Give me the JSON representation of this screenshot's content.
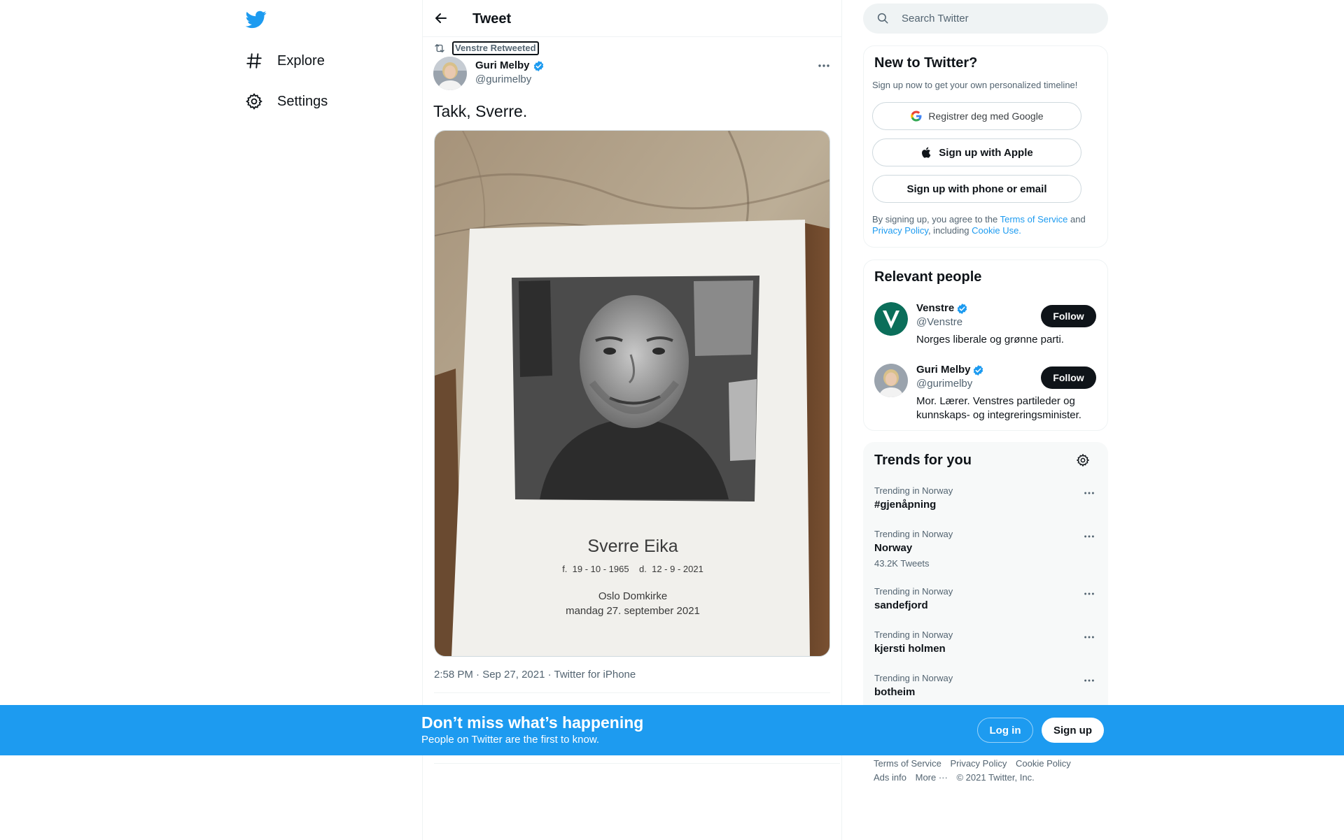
{
  "colors": {
    "brand": "#1d9bf0",
    "text": "#0f1419",
    "secondary_text": "#536471",
    "banner": "#1d9bf0"
  },
  "nav": {
    "logo_icon": "twitter-bird-icon",
    "items": [
      {
        "label": "Explore",
        "icon": "hashtag-icon"
      },
      {
        "label": "Settings",
        "icon": "gear-icon"
      }
    ]
  },
  "header": {
    "title": "Tweet",
    "back_icon": "arrow-left-icon"
  },
  "tweet": {
    "retweeted_by": "Venstre Retweeted",
    "author_name": "Guri Melby",
    "author_handle": "@gurimelby",
    "text": "Takk, Sverre.",
    "photo_card": {
      "name": "Sverre Eika",
      "dates": "f.  19 - 10 - 1965    d.  12 - 9 - 2021",
      "place": "Oslo Domkirke",
      "date_line": "mandag 27. september 2021"
    },
    "meta": "2:58 PM · Sep 27, 2021 · Twitter for iPhone"
  },
  "search": {
    "placeholder": "Search Twitter"
  },
  "new_to_twitter": {
    "title": "New to Twitter?",
    "subtitle": "Sign up now to get your own personalized timeline!",
    "google_label": "Registrer deg med Google",
    "apple_label": "Sign up with Apple",
    "phone_label": "Sign up with phone or email",
    "legal": {
      "prefix": "By signing up, you agree to the ",
      "terms": "Terms of Service",
      "and": " and ",
      "privacy": "Privacy Policy",
      "including": ", including ",
      "cookie": "Cookie Use."
    }
  },
  "relevant_people": {
    "title": "Relevant people",
    "people": [
      {
        "name": "Venstre",
        "handle": "@Venstre",
        "bio": "Norges liberale og grønne parti.",
        "follow": "Follow"
      },
      {
        "name": "Guri Melby",
        "handle": "@gurimelby",
        "bio": "Mor. Lærer. Venstres partileder og kunnskaps- og integreringsminister.",
        "follow": "Follow"
      }
    ]
  },
  "trends": {
    "title": "Trends for you",
    "items": [
      {
        "context": "Trending in Norway",
        "name": "#gjenåpning"
      },
      {
        "context": "Trending in Norway",
        "name": "Norway",
        "count": "43.2K Tweets"
      },
      {
        "context": "Trending in Norway",
        "name": "sandefjord"
      },
      {
        "context": "Trending in Norway",
        "name": "kjersti holmen"
      },
      {
        "context": "Trending in Norway",
        "name": "botheim"
      }
    ]
  },
  "footer": {
    "terms": "Terms of Service",
    "privacy": "Privacy Policy",
    "cookie": "Cookie Policy",
    "ads": "Ads info",
    "more": "More ···",
    "copyright": "© 2021 Twitter, Inc."
  },
  "banner": {
    "title": "Don’t miss what’s happening",
    "subtitle": "People on Twitter are the first to know.",
    "login": "Log in",
    "signup": "Sign up"
  }
}
